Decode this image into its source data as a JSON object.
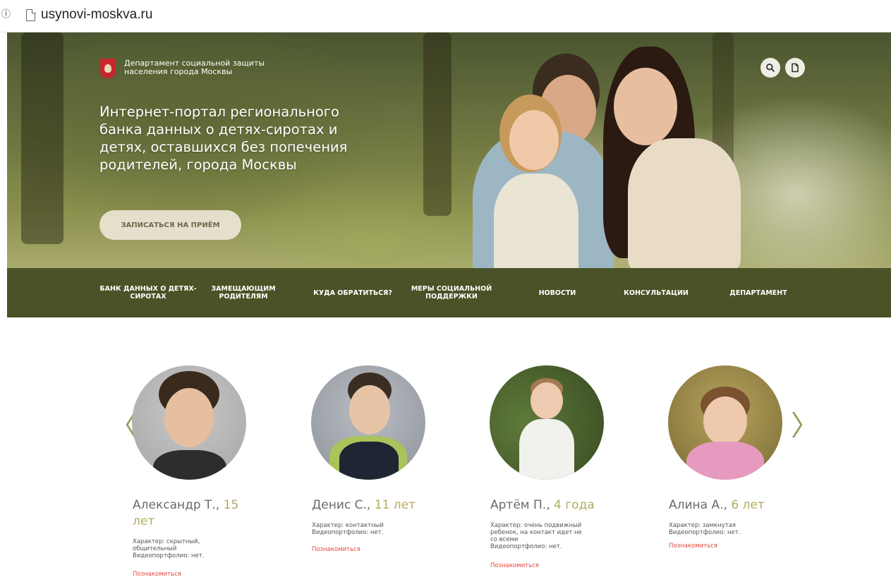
{
  "browser": {
    "url": "usynovi-moskva.ru"
  },
  "header": {
    "department": "Департамент социальной защиты\nнаселения города Москвы",
    "portal_title": "Интернет-портал регионального\nбанка данных о детях-сиротах и\nдетях, оставшихся без попечения\nродителей, города Москвы",
    "cta_label": "ЗАПИСАТЬСЯ НА ПРИЁМ"
  },
  "nav": {
    "items": [
      "БАНК ДАННЫХ О ДЕТЯХ-\nСИРОТАХ",
      "ЗАМЕЩАЮЩИМ\nРОДИТЕЛЯМ",
      "КУДА ОБРАТИТЬСЯ?",
      "МЕРЫ СОЦИАЛЬНОЙ\nПОДДЕРЖКИ",
      "НОВОСТИ",
      "КОНСУЛЬТАЦИИ",
      "ДЕПАРТАМЕНТ"
    ]
  },
  "carousel": {
    "prev": "〈",
    "next": "〉",
    "children": [
      {
        "name": "Александр Т., ",
        "age": "15 лет",
        "desc": "Характер: скрытный,\nобщительный\nВидеопортфолио: нет.",
        "link": "Познакомиться"
      },
      {
        "name": "Денис С., ",
        "age": "11 лет",
        "desc": "Характер: контактный\nВидеопортфолио: нет.",
        "link": "Познакомиться"
      },
      {
        "name": "Артём П., ",
        "age": "4 года",
        "desc": "Характер: очень подвижный\nребенок, на контакт идет не\nсо всеми\nВидеопортфолио: нет.",
        "link": "Познакомиться"
      },
      {
        "name": "Алина А., ",
        "age": "6 лет",
        "desc": "Характер: замкнутая\nВидеопортфолио: нет.",
        "link": "Познакомиться"
      }
    ]
  },
  "icons": {
    "search": "search-icon",
    "document": "document-icon",
    "logo": "moscow-coat-of-arms-icon"
  },
  "colors": {
    "nav_bg": "#4a5227",
    "age_accent": "#b4ab62",
    "link": "#e0463c",
    "arrow": "#8fa05a"
  }
}
